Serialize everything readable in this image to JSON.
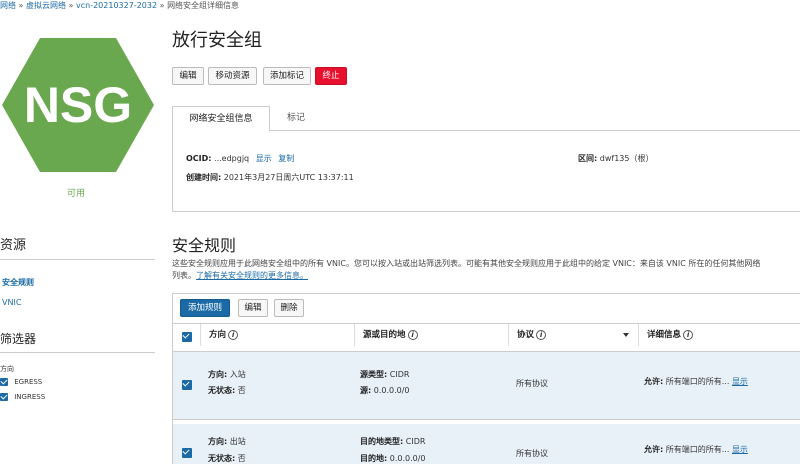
{
  "breadcrumb": {
    "items": [
      "网络",
      "虚拟云网络",
      "vcn-20210327-2032"
    ],
    "separator": "»",
    "current": "网络安全组详细信息"
  },
  "resource": {
    "icon_text": "NSG",
    "icon_color": "#6aa84f",
    "status": "可用"
  },
  "sidebar": {
    "resources_title": "资源",
    "items": [
      {
        "label": "安全规则",
        "active": true
      },
      {
        "label": "VNIC",
        "active": false
      }
    ],
    "filters_title": "筛选器",
    "direction_label": "方向",
    "filters": [
      {
        "label": "EGRESS",
        "checked": true
      },
      {
        "label": "INGRESS",
        "checked": true
      }
    ]
  },
  "header": {
    "title": "放行安全组",
    "buttons": {
      "edit": "编辑",
      "move": "移动资源",
      "tag": "添加标记",
      "terminate": "终止"
    }
  },
  "tabs": [
    {
      "label": "网络安全组信息",
      "active": true
    },
    {
      "label": "标记",
      "active": false
    }
  ],
  "info": {
    "ocid_label": "OCID:",
    "ocid_value": "...edpgjq",
    "show_link": "显示",
    "copy_link": "复制",
    "region_label": "区间:",
    "region_value": "dwf135（根）",
    "created_label": "创建时间:",
    "created_value": "2021年3月27日周六UTC 13:37:11"
  },
  "rules": {
    "title": "安全规则",
    "description": "这些安全规则应用于此网络安全组中的所有 VNIC。您可以按入站或出站筛选列表。可能有其他安全规则应用于此组中的给定 VNIC：来自该 VNIC 所在的任何其他网络",
    "description2_prefix": "列表。",
    "learn_more": "了解有关安全规则的更多信息。",
    "buttons": {
      "add": "添加规则",
      "edit": "编辑",
      "delete": "删除"
    },
    "columns": {
      "direction": "方向",
      "source_dest": "源或目的地",
      "protocol": "协议",
      "details": "详细信息"
    },
    "rows": [
      {
        "direction_label": "方向:",
        "direction_value": "入站",
        "stateless_label": "无状态:",
        "stateless_value": "否",
        "type_label": "源类型:",
        "type_value": "CIDR",
        "addr_label": "源:",
        "addr_value": "0.0.0.0/0",
        "protocol": "所有协议",
        "allow_label": "允许:",
        "allow_value": "所有端口的所有...",
        "show_link": "显示",
        "checked": true
      },
      {
        "direction_label": "方向:",
        "direction_value": "出站",
        "stateless_label": "无状态:",
        "stateless_value": "否",
        "type_label": "目的地类型:",
        "type_value": "CIDR",
        "addr_label": "目的地:",
        "addr_value": "0.0.0.0/0",
        "protocol": "所有协议",
        "allow_label": "允许:",
        "allow_value": "所有端口的所有...",
        "show_link": "显示",
        "checked": true
      }
    ]
  }
}
